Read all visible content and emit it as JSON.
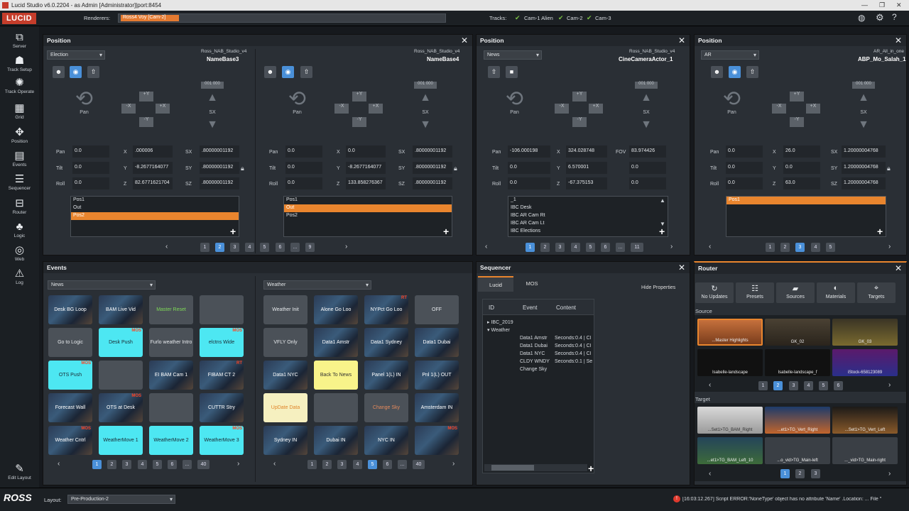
{
  "window": {
    "title": "Lucid Studio v6.0.2204 - as Admin [Administrator]|port:8454"
  },
  "topbar": {
    "logo": "LUCID",
    "renderers_label": "Renderers:",
    "renderer": "Ross4 Voy [Cam-2]",
    "tracks_label": "Tracks:",
    "tracks": [
      "Cam-1 Alien",
      "Cam-2",
      "Cam-3"
    ]
  },
  "sidebar": [
    {
      "icon": "server-icon",
      "label": "Server"
    },
    {
      "icon": "track-setup-icon",
      "label": "Track Setup"
    },
    {
      "icon": "track-operate-icon",
      "label": "Track Operate"
    },
    {
      "icon": "grid-icon",
      "label": "Grid"
    },
    {
      "icon": "position-icon",
      "label": "Position"
    },
    {
      "icon": "events-icon",
      "label": "Events"
    },
    {
      "icon": "sequencer-icon",
      "label": "Sequencer"
    },
    {
      "icon": "router-icon",
      "label": "Router"
    },
    {
      "icon": "logic-icon",
      "label": "Logic"
    },
    {
      "icon": "web-icon",
      "label": "Web"
    },
    {
      "icon": "log-icon",
      "label": "Log"
    },
    {
      "icon": "edit-layout-icon",
      "label": "Edit Layout"
    }
  ],
  "common": {
    "title": "Position",
    "pan": "Pan",
    "tilt": "Tilt",
    "roll": "Roll",
    "x": "X",
    "y": "Y",
    "z": "Z",
    "sx": "SX",
    "sy": "SY",
    "sz": "SZ",
    "fov": "FOV",
    "ptz_pan": "Pan",
    "ptz_sx": "SX",
    "plusy": "+Y",
    "minusy": "-Y",
    "plusx": "+X",
    "minusx": "-X",
    "b1": "001",
    "b2": "000",
    "ellipsis": "..."
  },
  "pos1": {
    "dropdown": "Election",
    "a": {
      "scene": "Ross_NAB_Studio_v4",
      "name": "NameBase3",
      "pan": "0.0",
      "tilt": "0.0",
      "roll": "0.0",
      "x": ".000006",
      "y": "-8.2677164077",
      "z": "82.6771621704",
      "sx": ".80000001192",
      "sy": ".80000001192",
      "sz": ".80000001192",
      "list": [
        "Pos1",
        "Out",
        "Pos2"
      ]
    },
    "b": {
      "scene": "Ross_NAB_Studio_v4",
      "name": "NameBase4",
      "pan": "0.0",
      "tilt": "0.0",
      "roll": "0.0",
      "x": "0.0",
      "y": "-8.2677164077",
      "z": "133.858276367",
      "sx": ".80000001192",
      "sy": ".80000001192",
      "sz": ".80000001192",
      "list": [
        "Pos1",
        "Out",
        "Pos2"
      ]
    },
    "pages": [
      "1",
      "2",
      "3",
      "4",
      "5",
      "6",
      "...",
      "9"
    ]
  },
  "pos2": {
    "dropdown": "News",
    "scene": "Ross_NAB_Studio_v4",
    "name": "CineCameraActor_1",
    "pan": "-106.000198",
    "tilt": "0.0",
    "roll": "0.0",
    "x": "324.028748",
    "y": "6.570001",
    "z": "-67.375153",
    "fov": "83.974426",
    "f2": "0.0",
    "f3": "0.0",
    "list": [
      "_1",
      "IBC Desk",
      "IBC AR Cam Rt",
      "IBC AR Cam Lt",
      "IBC Elections"
    ],
    "pages": [
      "1",
      "2",
      "3",
      "4",
      "5",
      "6",
      "...",
      "11"
    ]
  },
  "pos3": {
    "dropdown": "AR",
    "scene": "AR_All_in_one",
    "name": "ABP_Mo_Salah_1",
    "pan": "0.0",
    "tilt": "0.0",
    "roll": "0.0",
    "x": "26.0",
    "y": "0.0",
    "z": "63.0",
    "sx": "1.20000004768",
    "sy": "1.20000004768",
    "sz": "1.20000004768",
    "list": [
      "Pos1"
    ],
    "pages": [
      "1",
      "2",
      "3",
      "4",
      "5"
    ]
  },
  "events": {
    "title": "Events",
    "left": {
      "dropdown": "News",
      "tiles": [
        [
          "Desk BG Loop",
          "BAM Live Vid",
          "Master Reset",
          ""
        ],
        [
          "Go to Logic",
          "Desk Push",
          "Furlo weather Intro",
          "elctns Wide"
        ],
        [
          "OTS Push",
          "",
          "EI BAM Cam 1",
          "FIBAM CT 2"
        ],
        [
          "Forecast Wall",
          "OTS at Desk",
          "",
          "CUTTR Stry"
        ],
        [
          "Weather Cntrl",
          "WeatherMove 1",
          "WeatherMove 2",
          "WeatherMove 3"
        ]
      ],
      "pages": [
        "1",
        "2",
        "3",
        "4",
        "5",
        "6",
        "...",
        "40"
      ]
    },
    "right": {
      "dropdown": "Weather",
      "tiles": [
        [
          "Weather Init",
          "Alone Go Loo",
          "NYPct Go Loo",
          "OFF"
        ],
        [
          "VFLY Only",
          "Data1 Amstr",
          "Data1 Sydney",
          "Data1 Dubai"
        ],
        [
          "Data1 NYC",
          "Back To News",
          "Panel 1(L) IN",
          "Pnl 1(L) OUT"
        ],
        [
          "UpDate Data",
          "",
          "Change Sky",
          "Amsterdam IN"
        ],
        [
          "Sydney IN",
          "Dubai IN",
          "NYC IN",
          ""
        ]
      ],
      "pages": [
        "1",
        "2",
        "3",
        "4",
        "5",
        "6",
        "...",
        "40"
      ]
    },
    "mos": "MOS",
    "rt": "RT"
  },
  "sequencer": {
    "title": "Sequencer",
    "tabs": [
      "Lucid",
      "MOS"
    ],
    "hide": "Hide Properties",
    "cols": [
      "ID",
      "Event",
      "Content"
    ],
    "rows": [
      {
        "id": "IBC_2019",
        "event": "",
        "content": ""
      },
      {
        "id": "Weather",
        "event": "",
        "content": ""
      },
      {
        "id": "",
        "event": "Data1 Amstr",
        "content": "Seconds:0.4 | Cl"
      },
      {
        "id": "",
        "event": "Data1 Dubai",
        "content": "Seconds:0.4 | Cl"
      },
      {
        "id": "",
        "event": "Data1 NYC",
        "content": "Seconds:0.4 | Cl"
      },
      {
        "id": "",
        "event": "CLDY WNDY",
        "content": "Seconds:0.1 | Se"
      },
      {
        "id": "",
        "event": "Change Sky",
        "content": ""
      }
    ]
  },
  "router": {
    "title": "Router",
    "buttons": [
      {
        "icon": "refresh-icon",
        "label": "No Updates"
      },
      {
        "icon": "sliders-icon",
        "label": "Presets"
      },
      {
        "icon": "folder-icon",
        "label": "Sources"
      },
      {
        "icon": "palette-icon",
        "label": "Materials"
      },
      {
        "icon": "crosshair-icon",
        "label": "Targets"
      }
    ],
    "source_label": "Source",
    "sources": [
      "...Master Highlights",
      "GK_02",
      "GK_03",
      "Isabelle-landscape",
      "Isabelle-landscape_f",
      "iStock-658123089"
    ],
    "source_pages": [
      "1",
      "2",
      "3",
      "4",
      "5",
      "6"
    ],
    "target_label": "Target",
    "targets": [
      "...Set1>TG_BAM_Right",
      "...et1>TG_Vert_Right",
      "...Set1>TG_Vert_Left",
      "...et1>TG_BAM_Left_10",
      "...o_vid>TG_Main-left",
      "..._vid>TG_Main-right"
    ],
    "target_pages": [
      "1",
      "2",
      "3"
    ]
  },
  "bottom": {
    "logo": "ROSS",
    "layout_label": "Layout:",
    "layout": "Pre-Production-2",
    "status": "[16:03:12.267] Script ERROR:'NoneType' object has no attribute 'Name' .Location: ... File \""
  }
}
